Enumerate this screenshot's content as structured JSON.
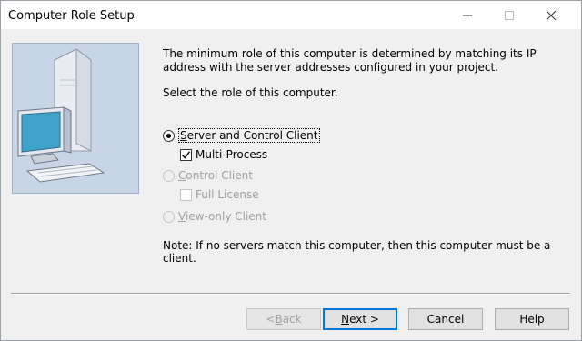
{
  "window": {
    "title": "Computer Role Setup"
  },
  "description": "The minimum role of this computer is determined by matching its IP address with the server addresses configured in your project.",
  "prompt": "Select the role of this computer.",
  "options": {
    "server": {
      "mnemonic": "S",
      "label_rest": "erver and Control Client",
      "selected": true
    },
    "multi_process": {
      "label": "Multi-Process",
      "checked": true
    },
    "control": {
      "mnemonic": "C",
      "label_rest": "ontrol Client",
      "enabled": false
    },
    "full_license": {
      "label": "Full License",
      "checked": false,
      "enabled": false
    },
    "view_only": {
      "mnemonic": "V",
      "label_rest": "iew-only Client",
      "enabled": false
    }
  },
  "note": "Note: If no servers match this computer, then this computer must be a client.",
  "buttons": {
    "back": {
      "pre": "< ",
      "mnemonic": "B",
      "rest": "ack",
      "enabled": false
    },
    "next": {
      "mnemonic": "N",
      "rest": "ext >"
    },
    "cancel": "Cancel",
    "help": "Help"
  },
  "colors": {
    "illustration_bg": "#c7d5e6",
    "default_button_border": "#0078d7"
  }
}
